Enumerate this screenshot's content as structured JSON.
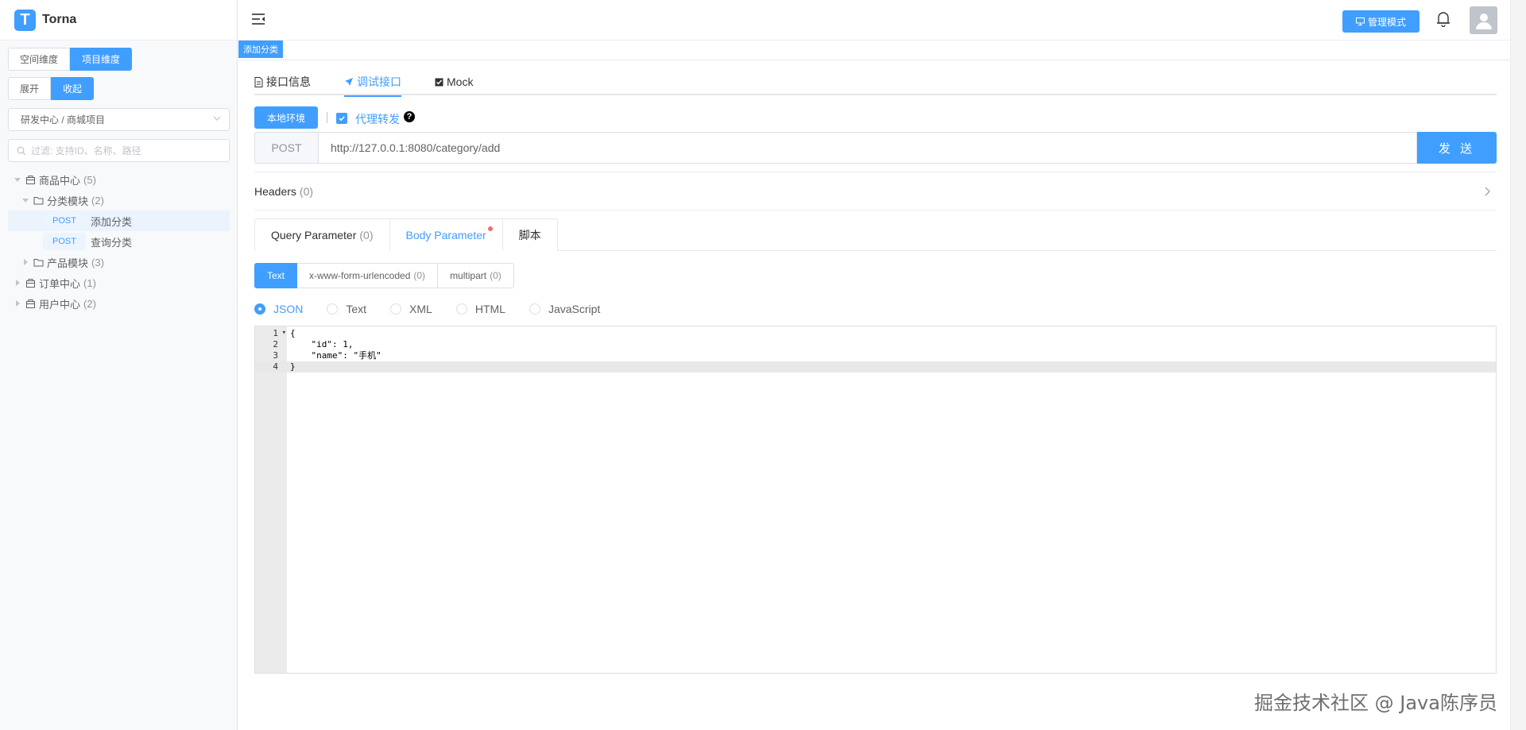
{
  "app": {
    "name": "Torna",
    "logo_letter": "T"
  },
  "sidebar": {
    "dimension_tabs": [
      {
        "label": "空间维度",
        "active": false
      },
      {
        "label": "项目维度",
        "active": true
      }
    ],
    "expand_tabs": [
      {
        "label": "展开",
        "active": false
      },
      {
        "label": "收起",
        "active": true
      }
    ],
    "project_select": "研发中心 / 商城项目",
    "filter_placeholder": "过滤: 支持ID、名称、路径",
    "tree": [
      {
        "label": "商品中心",
        "count": "(5)",
        "type": "module",
        "expanded": true,
        "level": 0
      },
      {
        "label": "分类模块",
        "count": "(2)",
        "type": "folder",
        "expanded": true,
        "level": 1
      },
      {
        "method": "POST",
        "label": "添加分类",
        "type": "api",
        "selected": true,
        "level": 2
      },
      {
        "method": "POST",
        "label": "查询分类",
        "type": "api",
        "selected": false,
        "level": 2
      },
      {
        "label": "产品模块",
        "count": "(3)",
        "type": "folder",
        "expanded": false,
        "level": 1
      },
      {
        "label": "订单中心",
        "count": "(1)",
        "type": "module",
        "expanded": false,
        "level": 0
      },
      {
        "label": "用户中心",
        "count": "(2)",
        "type": "module",
        "expanded": false,
        "level": 0
      }
    ]
  },
  "header": {
    "admin_mode": "管理模式",
    "icons": [
      "menu-fold-icon",
      "bell-icon",
      "user-avatar-icon"
    ]
  },
  "page_tag": "添加分类",
  "tabs": [
    {
      "label": "接口信息",
      "icon": "document-icon",
      "active": false
    },
    {
      "label": "调试接口",
      "icon": "send-icon",
      "active": true
    },
    {
      "label": "Mock",
      "icon": "checkbox-icon",
      "active": false
    }
  ],
  "debug": {
    "env_button": "本地环境",
    "proxy_label": "代理转发",
    "proxy_checked": true,
    "method": "POST",
    "url": "http://127.0.0.1:8080/category/add",
    "send": "发 送",
    "headers_label": "Headers",
    "headers_count": "(0)"
  },
  "param_tabs": [
    {
      "label": "Query Parameter",
      "count": "(0)",
      "active": false,
      "dot": false
    },
    {
      "label": "Body Parameter",
      "count": "",
      "active": true,
      "dot": true
    },
    {
      "label": "脚本",
      "count": "",
      "active": false,
      "dot": false
    }
  ],
  "body_types": [
    {
      "label": "Text",
      "count": "",
      "active": true
    },
    {
      "label": "x-www-form-urlencoded",
      "count": "(0)",
      "active": false
    },
    {
      "label": "multipart",
      "count": "(0)",
      "active": false
    }
  ],
  "formats": [
    {
      "label": "JSON",
      "active": true
    },
    {
      "label": "Text",
      "active": false
    },
    {
      "label": "XML",
      "active": false
    },
    {
      "label": "HTML",
      "active": false
    },
    {
      "label": "JavaScript",
      "active": false
    }
  ],
  "editor": {
    "lines": [
      {
        "num": "1",
        "text": "{"
      },
      {
        "num": "2",
        "text": "    \"id\": 1,"
      },
      {
        "num": "3",
        "text": "    \"name\": \"手机\""
      },
      {
        "num": "4",
        "text": "}"
      }
    ],
    "active_line": 4
  },
  "watermark": "掘金技术社区 @ Java陈序员",
  "colors": {
    "primary": "#409eff",
    "dot": "#f56c6c"
  }
}
